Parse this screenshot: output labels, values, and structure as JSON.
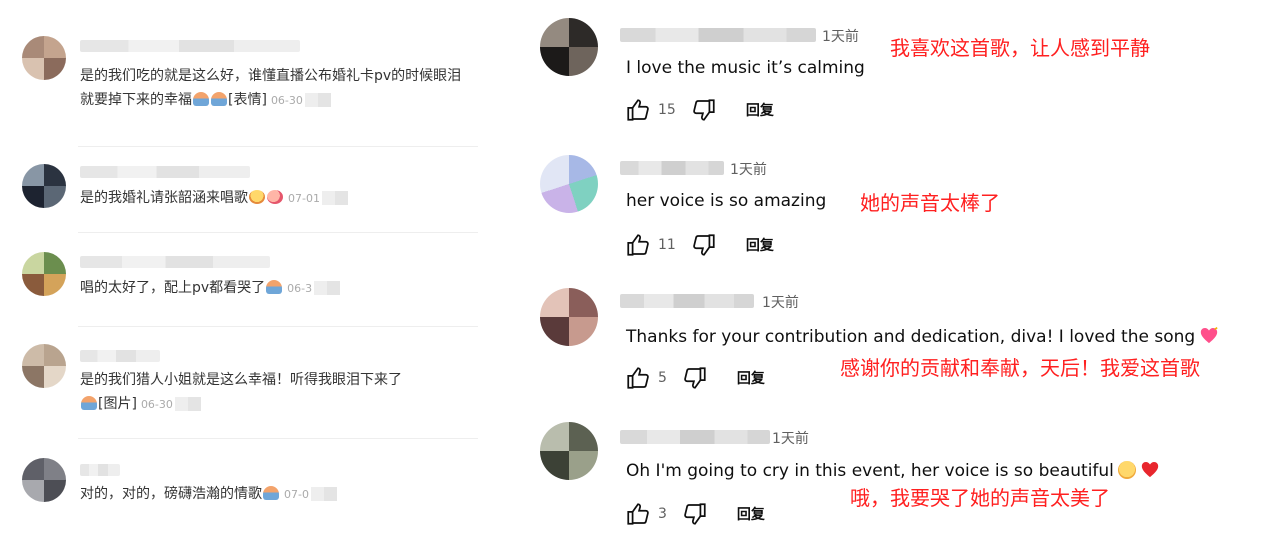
{
  "left_comments": [
    {
      "text": "是的我们吃的就是这么好，谁懂直播公布婚礼卡pv的时候眼泪就要掉下来的幸福",
      "suffix": "[表情]",
      "date": "06-30"
    },
    {
      "text": "是的我婚礼请张韶涵来唱歌",
      "suffix": "",
      "date": "07-01"
    },
    {
      "text": "唱的太好了，配上pv都看哭了",
      "suffix": "",
      "date": "06-3"
    },
    {
      "text": "是的我们猎人小姐就是这么幸福！听得我眼泪下来了",
      "suffix": "[图片]",
      "date": "06-30"
    },
    {
      "text": "对的，对的，磅礴浩瀚的情歌",
      "suffix": "",
      "date": "07-0"
    }
  ],
  "right_comments": [
    {
      "time": "1天前",
      "text": "I love the music it’s calming",
      "translation": "我喜欢这首歌，让人感到平静",
      "likes": "15",
      "reply": "回复"
    },
    {
      "time": "1天前",
      "text": "her voice is so amazing",
      "translation": "她的声音太棒了",
      "likes": "11",
      "reply": "回复"
    },
    {
      "time": "1天前",
      "text": "Thanks for your contribution and dedication, diva! I loved the song",
      "translation": "感谢你的贡献和奉献，天后！我爱这首歌",
      "likes": "5",
      "reply": "回复"
    },
    {
      "time": "1天前",
      "text": "Oh I'm going to cry in this event, her voice is so beautiful",
      "translation": "哦，我要哭了她的声音太美了",
      "likes": "3",
      "reply": "回复"
    }
  ],
  "colors": {
    "translation": "#ff2020",
    "meta": "#aaaaaa"
  },
  "icons": [
    "thumb-up-icon",
    "thumb-down-icon",
    "heart-emoji",
    "crying-face-emoji"
  ]
}
